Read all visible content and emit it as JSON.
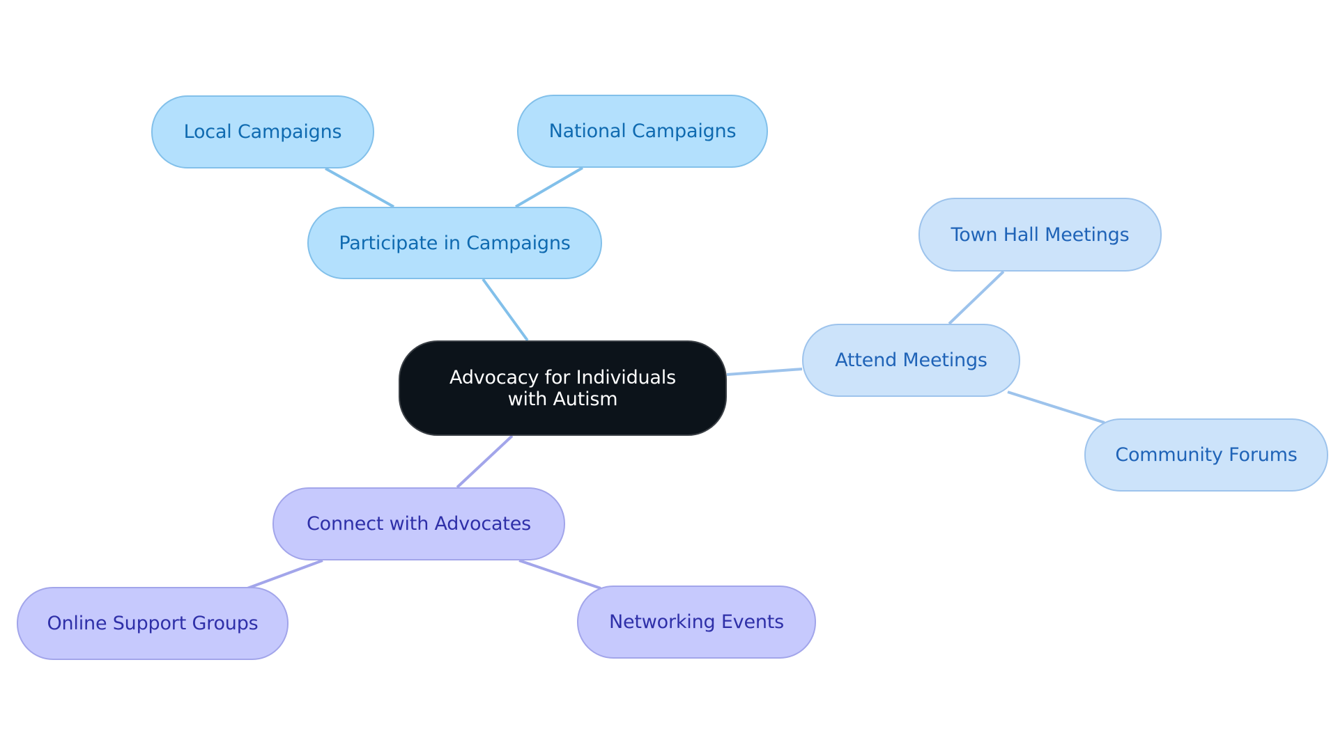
{
  "diagram": {
    "type": "mind-map",
    "root": {
      "id": "root",
      "label": "Advocacy for Individuals with Autism"
    },
    "branches": [
      {
        "id": "participate",
        "label": "Participate in Campaigns",
        "group": "campaigns",
        "children": [
          {
            "id": "local",
            "label": "Local Campaigns"
          },
          {
            "id": "national",
            "label": "National Campaigns"
          }
        ]
      },
      {
        "id": "attend",
        "label": "Attend Meetings",
        "group": "meetings",
        "children": [
          {
            "id": "townhall",
            "label": "Town Hall Meetings"
          },
          {
            "id": "community",
            "label": "Community Forums"
          }
        ]
      },
      {
        "id": "connect",
        "label": "Connect with Advocates",
        "group": "advocates",
        "children": [
          {
            "id": "online",
            "label": "Online Support Groups"
          },
          {
            "id": "networking",
            "label": "Networking Events"
          }
        ]
      }
    ],
    "colors": {
      "root_fill": "#0c131a",
      "campaigns_fill": "#b3e0fd",
      "campaigns_edge": "#82c0ea",
      "campaigns_text": "#0f6ab0",
      "meetings_fill": "#cce3fa",
      "meetings_edge": "#9dc3ec",
      "meetings_text": "#1f63b7",
      "advocates_fill": "#c6c9fd",
      "advocates_edge": "#a2a5ea",
      "advocates_text": "#2e2fa8"
    }
  }
}
